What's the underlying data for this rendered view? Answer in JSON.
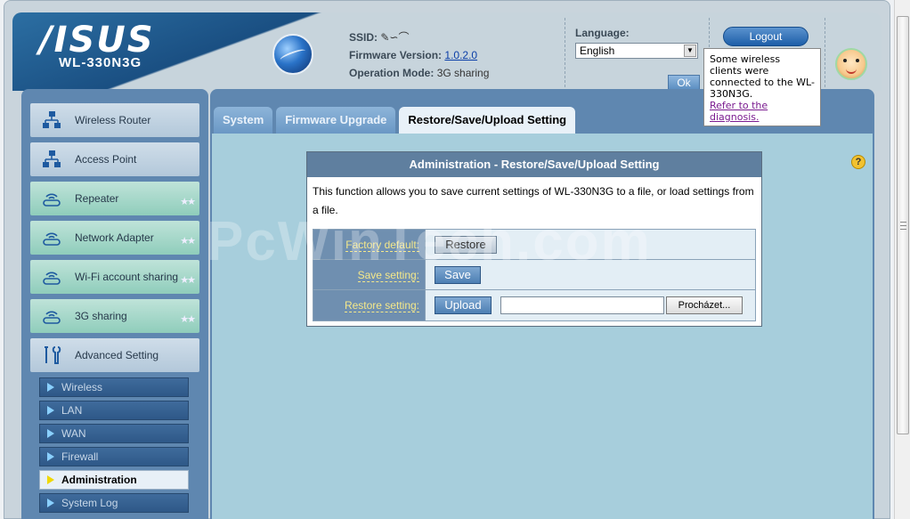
{
  "header": {
    "brand": "/ISUS",
    "model": "WL-330N3G",
    "ssid_label": "SSID:",
    "ssid_value": "✎∽⌒",
    "firmware_label": "Firmware Version:",
    "firmware_value": "1.0.2.0",
    "opmode_label": "Operation Mode:",
    "opmode_value": "3G sharing",
    "language_label": "Language:",
    "language_value": "English",
    "ok_label": "Ok",
    "logout_label": "Logout",
    "tooltip_text": "Some wireless clients were connected to the WL-330N3G.",
    "tooltip_link": "Refer to the diagnosis."
  },
  "sidebar": {
    "items": [
      {
        "label": "Wireless Router"
      },
      {
        "label": "Access Point"
      },
      {
        "label": "Repeater",
        "stars": "★★"
      },
      {
        "label": "Network Adapter",
        "stars": "★★"
      },
      {
        "label": "Wi-Fi account sharing",
        "stars": "★★"
      },
      {
        "label": "3G sharing",
        "stars": "★★"
      },
      {
        "label": "Advanced Setting"
      }
    ],
    "subitems": [
      {
        "label": "Wireless"
      },
      {
        "label": "LAN"
      },
      {
        "label": "WAN"
      },
      {
        "label": "Firewall"
      },
      {
        "label": "Administration"
      },
      {
        "label": "System Log"
      }
    ]
  },
  "tabs": [
    {
      "label": "System"
    },
    {
      "label": "Firmware Upgrade"
    },
    {
      "label": "Restore/Save/Upload Setting"
    }
  ],
  "panel": {
    "help": "?",
    "title": "Administration - Restore/Save/Upload Setting",
    "description": "This function allows you to save current settings of WL-330N3G to a file, or load settings from a file.",
    "rows": [
      {
        "label": "Factory default:",
        "button": "Restore"
      },
      {
        "label": "Save setting:",
        "button": "Save"
      },
      {
        "label": "Restore setting:",
        "button": "Upload",
        "browse": "Procházet..."
      }
    ]
  },
  "watermark": "PcWinTech.com",
  "colors": {
    "accent": "#5f87b0",
    "panel_bg": "#a7cedc",
    "label_text": "#f5e88a"
  }
}
